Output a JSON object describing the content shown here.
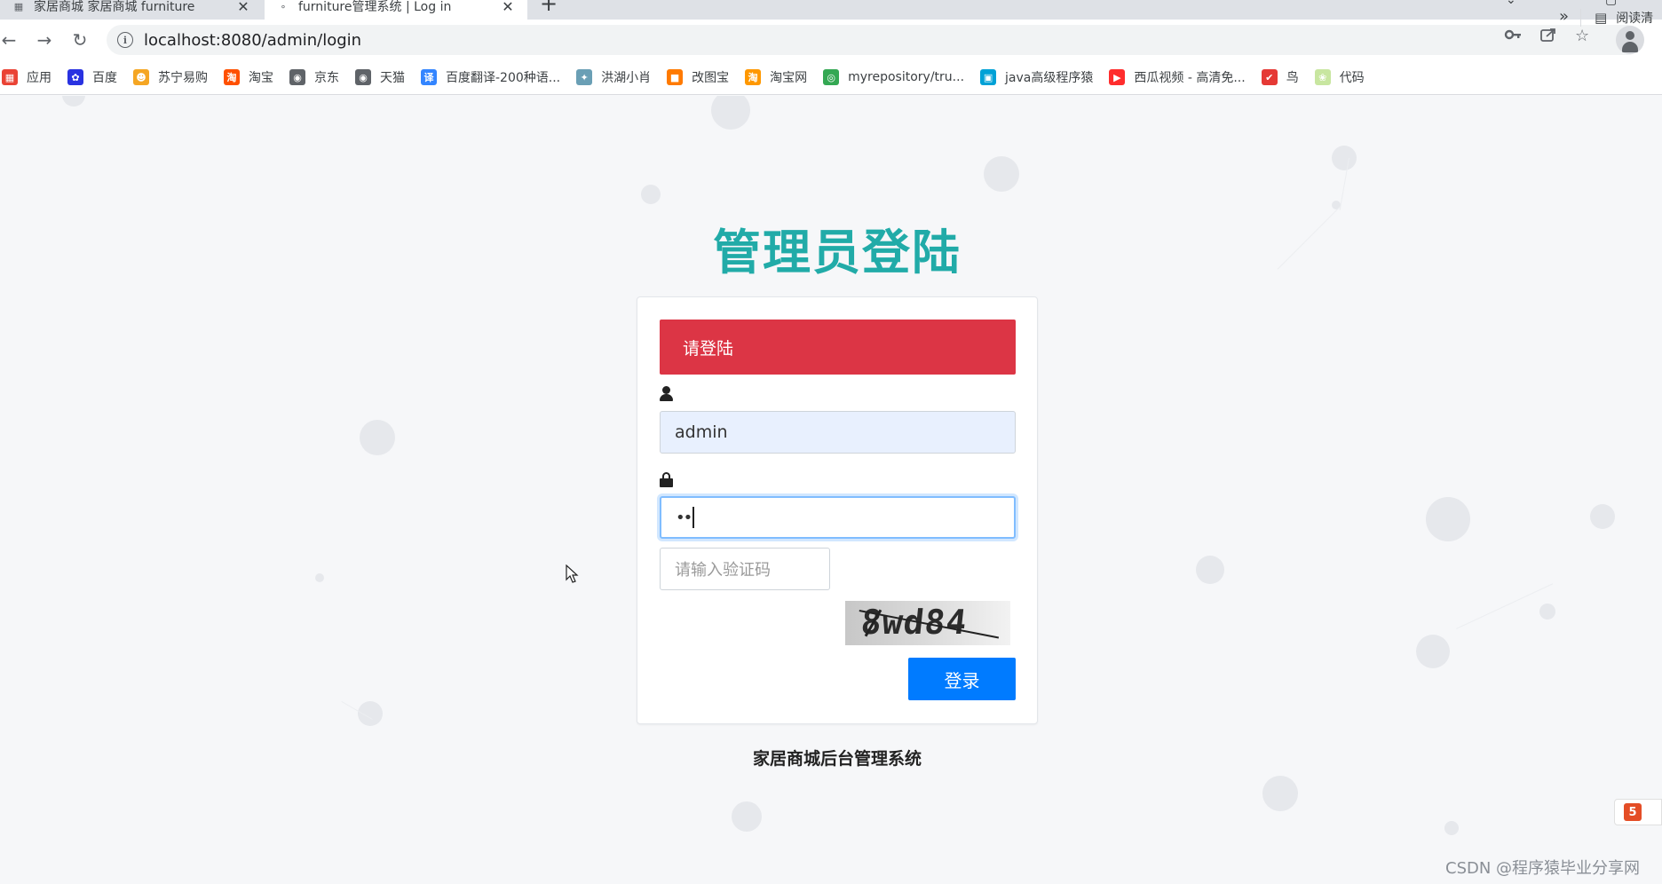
{
  "browser": {
    "tabs": [
      {
        "title": "家居商城 家居商城 furniture",
        "active": false
      },
      {
        "title": "furniture管理系统 | Log in",
        "active": true
      }
    ],
    "new_tab_icon": "plus-icon",
    "url": "localhost:8080/admin/login",
    "bookmarks": [
      {
        "label": "应用",
        "icon": "apps-grid-icon",
        "color": "#ea4335"
      },
      {
        "label": "百度",
        "icon": "baidu-paw-icon",
        "color": "#2932e1"
      },
      {
        "label": "苏宁易购",
        "icon": "suning-lion-icon",
        "color": "#f5a623"
      },
      {
        "label": "淘宝",
        "icon": "taobao-icon",
        "color": "#ff5000"
      },
      {
        "label": "京东",
        "icon": "globe-icon",
        "color": "#5f6368"
      },
      {
        "label": "天猫",
        "icon": "globe-icon",
        "color": "#5f6368"
      },
      {
        "label": "百度翻译-200种语...",
        "icon": "translate-icon",
        "color": "#3385ff"
      },
      {
        "label": "洪湖小肖",
        "icon": "bird-icon",
        "color": "#6a9fb5"
      },
      {
        "label": "改图宝",
        "icon": "gaitubao-icon",
        "color": "#ff7a00"
      },
      {
        "label": "淘宝网",
        "icon": "taobao-icon",
        "color": "#ff9800"
      },
      {
        "label": "myrepository/tru...",
        "icon": "chrome-icon",
        "color": "#34a853"
      },
      {
        "label": "java高级程序猿",
        "icon": "bilibili-icon",
        "color": "#00a1d6"
      },
      {
        "label": "西瓜视频 - 高清免...",
        "icon": "xigua-icon",
        "color": "#ff2d2d"
      },
      {
        "label": "鸟",
        "icon": "bird-red-icon",
        "color": "#e53935"
      },
      {
        "label": "代码",
        "icon": "code-leaf-icon",
        "color": "#c8e6a0"
      }
    ],
    "bookmarks_more": "»",
    "reading_list": "阅读清"
  },
  "login": {
    "heading": "管理员登陆",
    "alert": "请登陆",
    "username_value": "admin",
    "password_value": "••",
    "captcha_placeholder": "请输入验证码",
    "captcha_image_text": "8wd84",
    "submit_label": "登录"
  },
  "footer": {
    "system_title": "家居商城后台管理系统"
  },
  "watermark": "CSDN @程序猿毕业分享网",
  "colors": {
    "heading": "#21aba8",
    "alert": "#dc3545",
    "submit": "#007bff"
  }
}
